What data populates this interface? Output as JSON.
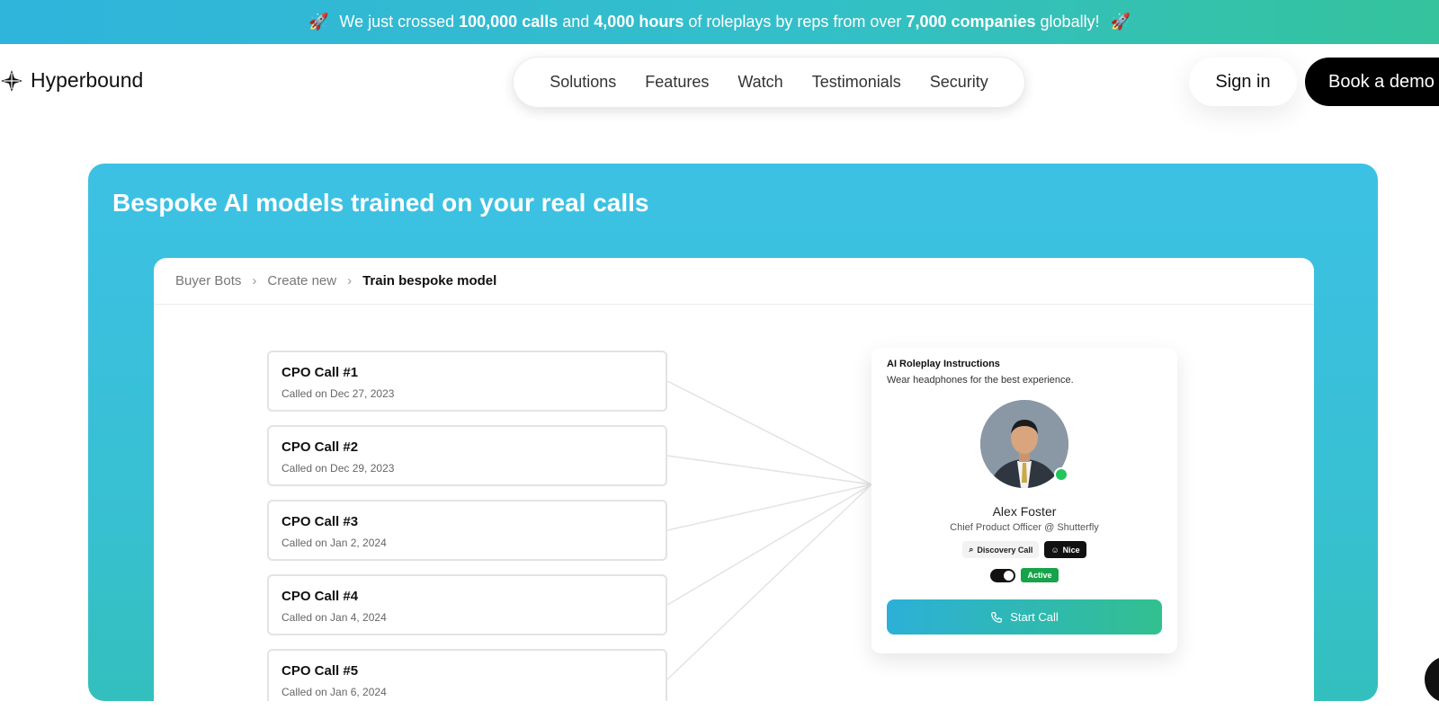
{
  "announcement": {
    "prefix": "We just crossed ",
    "calls": "100,000 calls",
    "and": " and ",
    "hours": "4,000 hours",
    "middle": " of roleplays by reps from over ",
    "companies": "7,000 companies",
    "suffix": " globally!"
  },
  "header": {
    "logo_text": "Hyperbound",
    "nav": [
      "Solutions",
      "Features",
      "Watch",
      "Testimonials",
      "Security"
    ],
    "signin": "Sign in",
    "book_demo": "Book a demo"
  },
  "hero": {
    "title": "Bespoke AI models trained on your real calls"
  },
  "breadcrumbs": [
    "Buyer Bots",
    "Create new",
    "Train bespoke model"
  ],
  "calls": [
    {
      "title": "CPO Call #1",
      "date": "Called on Dec 27, 2023"
    },
    {
      "title": "CPO Call #2",
      "date": "Called on Dec 29, 2023"
    },
    {
      "title": "CPO Call #3",
      "date": "Called on Jan 2, 2024"
    },
    {
      "title": "CPO Call #4",
      "date": "Called on Jan 4, 2024"
    },
    {
      "title": "CPO Call #5",
      "date": "Called on Jan 6, 2024"
    }
  ],
  "bot": {
    "heading": "AI Roleplay Instructions",
    "instructions": "Wear headphones for the best experience.",
    "name": "Alex Foster",
    "role": "Chief Product Officer @ Shutterfly",
    "tag_call": "Discovery Call",
    "tag_mood": "Nice",
    "status": "Active",
    "start_call": "Start Call"
  },
  "colors": {
    "accent_blue": "#2fb4dc",
    "accent_green": "#34c39c",
    "active_green": "#16a34a"
  }
}
